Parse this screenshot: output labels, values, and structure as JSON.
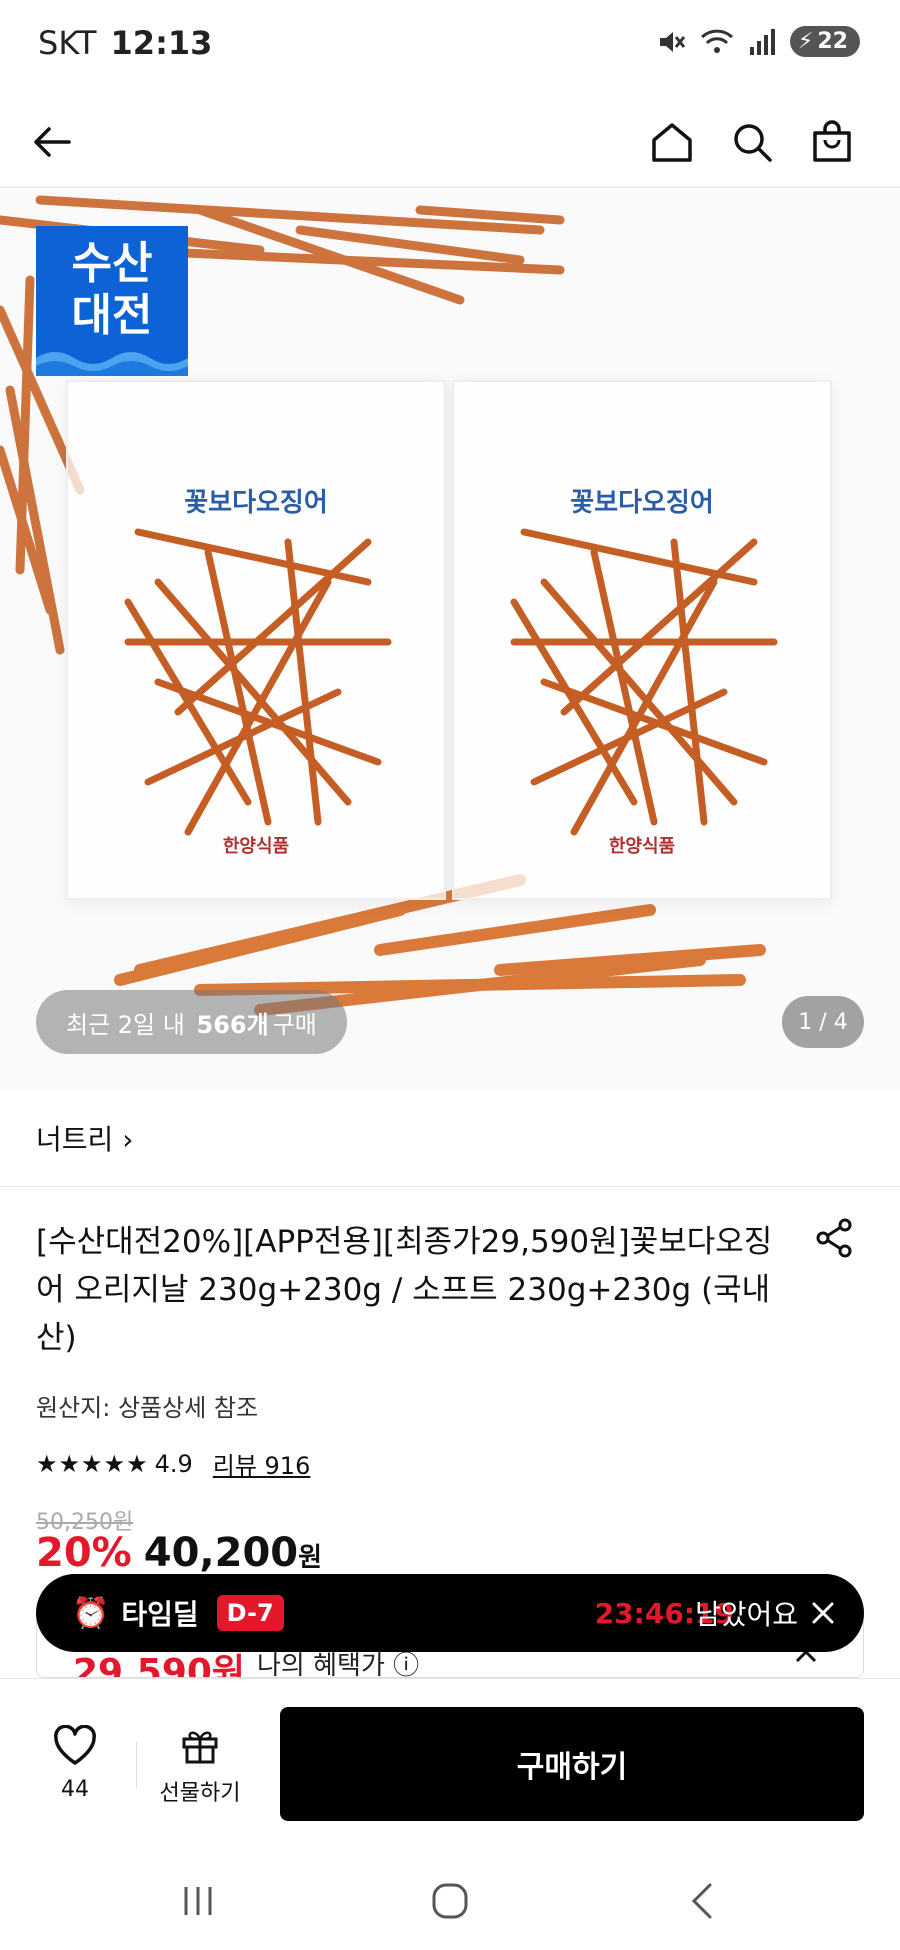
{
  "status_bar": {
    "carrier": "SKT",
    "time": "12:13",
    "battery": "22",
    "icons": [
      "mute-icon",
      "wifi-icon",
      "signal-icon",
      "battery-charging-icon"
    ]
  },
  "nav": {
    "icons": [
      "back-arrow-icon",
      "home-icon",
      "search-icon",
      "shopping-bag-icon"
    ]
  },
  "hero": {
    "badge_line1": "수산",
    "badge_line2": "대전",
    "bag_brand": "꽃보다오징어",
    "bag_maker": "한양식품",
    "purchase_prefix": "최근 2일 내",
    "purchase_count": "566개",
    "purchase_suffix": "구매",
    "counter": "1 / 4"
  },
  "seller": {
    "name": "너트리",
    "chevron": "›"
  },
  "product": {
    "title": "[수산대전20%][APP전용][최종가29,590원]꽃보다오징어 오리지날 230g+230g / 소프트 230g+230g (국내산)",
    "origin": "원산지: 상품상세 참조",
    "stars": "★★★★★",
    "rating": "4.9",
    "reviews": "리뷰 916",
    "original_price": "50,250원",
    "discount_percent": "20%",
    "discount_price": "40,200",
    "won": "원",
    "benefit_price": "29,590원",
    "benefit_label": "나의 혜택가 ⓘ"
  },
  "timedeal": {
    "label": "타임딜",
    "dday": "D-7",
    "countdown": "23:46:19",
    "remaining": "남았어요"
  },
  "bottom_bar": {
    "like_count": "44",
    "gift_label": "선물하기",
    "buy_label": "구매하기"
  },
  "colors": {
    "accent_red": "#e4182b",
    "badge_blue": "#0d63d6",
    "black": "#000000"
  }
}
